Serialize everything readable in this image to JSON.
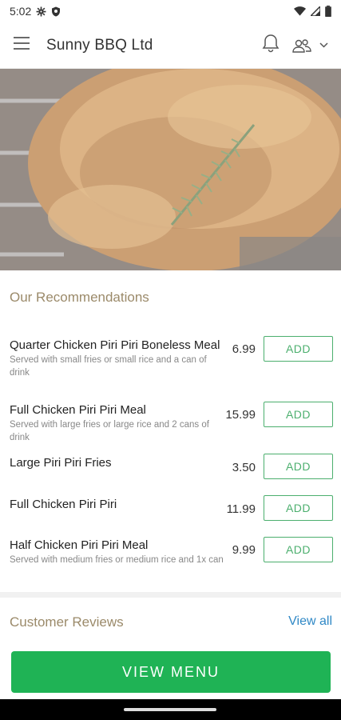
{
  "status_bar": {
    "time": "5:02"
  },
  "app_bar": {
    "title": "Sunny BBQ Ltd"
  },
  "recommendations": {
    "title": "Our Recommendations",
    "items": [
      {
        "name": "Quarter Chicken Piri Piri Boneless Meal",
        "description": "Served with small fries or small rice and a can of drink",
        "price": "6.99",
        "button": "ADD"
      },
      {
        "name": "Full Chicken Piri Piri Meal",
        "description": "Served with large fries or large rice and 2 cans of drink",
        "price": "15.99",
        "button": "ADD"
      },
      {
        "name": "Large Piri Piri Fries",
        "description": "",
        "price": "3.50",
        "button": "ADD"
      },
      {
        "name": "Full Chicken Piri Piri",
        "description": "",
        "price": "11.99",
        "button": "ADD"
      },
      {
        "name": "Half Chicken Piri Piri Meal",
        "description": "Served with medium fries or medium rice and 1x can",
        "price": "9.99",
        "button": "ADD"
      }
    ]
  },
  "reviews": {
    "title": "Customer Reviews",
    "view_all": "View all"
  },
  "footer": {
    "view_menu": "VIEW MENU"
  },
  "colors": {
    "accent_green": "#1fb355",
    "add_green": "#4caf6e",
    "section_title": "#9b8a6a",
    "link_blue": "#2f88c6"
  }
}
